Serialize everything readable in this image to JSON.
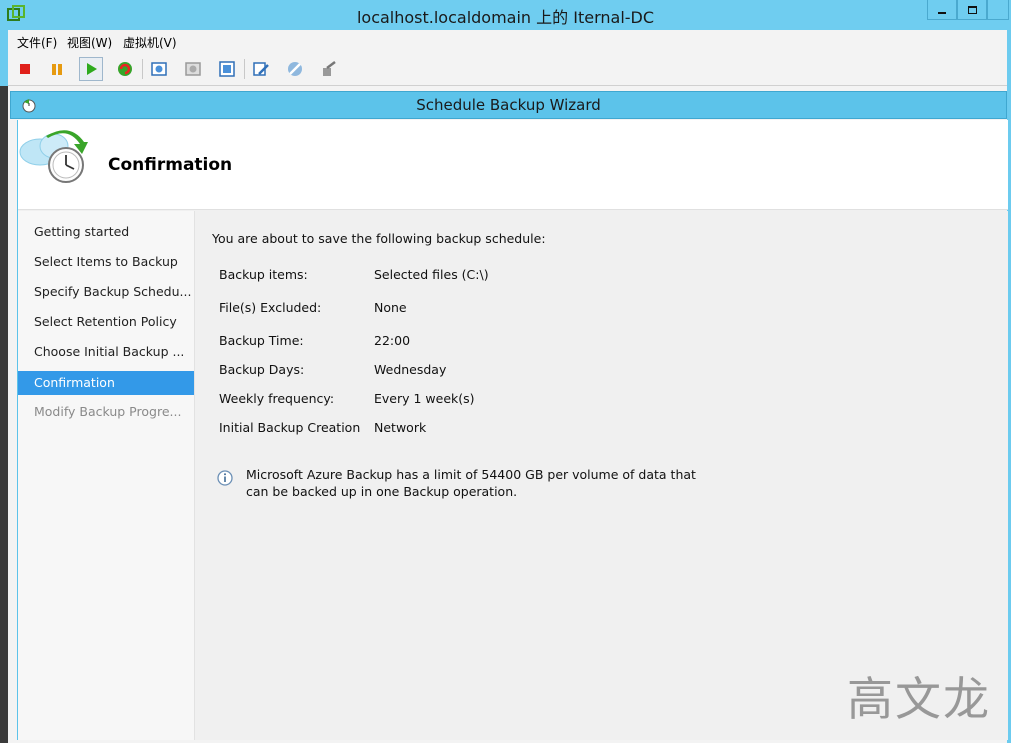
{
  "window": {
    "title": "localhost.localdomain 上的 Iternal-DC"
  },
  "menu": {
    "items": [
      "文件(F)",
      "视图(W)",
      "虚拟机(V)"
    ]
  },
  "toolbar": {
    "buttons": [
      "stop-icon",
      "pause-icon",
      "play-icon",
      "reset-icon",
      "snapshot-icon",
      "revert-snapshot-icon",
      "manage-snapshot-icon",
      "edit-settings-icon",
      "vm-tools-icon",
      "connect-device-icon"
    ]
  },
  "wizard": {
    "title": "Schedule Backup Wizard",
    "header_title": "Confirmation",
    "nav": [
      {
        "label": "Getting started",
        "state": "normal"
      },
      {
        "label": "Select Items to Backup",
        "state": "normal"
      },
      {
        "label": "Specify Backup Schedu...",
        "state": "normal"
      },
      {
        "label": "Select Retention Policy",
        "state": "normal"
      },
      {
        "label": "Choose Initial Backup ...",
        "state": "normal"
      },
      {
        "label": "Confirmation",
        "state": "active"
      },
      {
        "label": "Modify Backup Progre...",
        "state": "disabled"
      }
    ],
    "intro": "You are about to save the following backup schedule:",
    "summary": [
      {
        "label": "Backup items:",
        "value": "Selected files (C:\\)"
      },
      {
        "label": "File(s) Excluded:",
        "value": "None"
      },
      {
        "label": "Backup Time:",
        "value": "22:00"
      },
      {
        "label": "Backup Days:",
        "value": "Wednesday"
      },
      {
        "label": "Weekly frequency:",
        "value": "Every 1 week(s)"
      },
      {
        "label": "Initial Backup Creation",
        "value": "Network"
      }
    ],
    "info": "Microsoft Azure Backup has a limit of 54400 GB per volume of data that can be backed up in one Backup operation."
  },
  "watermark": "高文龙",
  "colors": {
    "titlebar": "#6fcdf0",
    "active_nav": "#3399e8"
  }
}
